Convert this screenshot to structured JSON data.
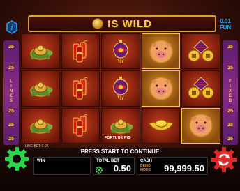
{
  "banner": {
    "title": "IS WILD"
  },
  "denomination": {
    "line1": "0.01",
    "line2": "FUN"
  },
  "side_left": {
    "numbers": [
      "25",
      "25",
      "25",
      "25",
      "25",
      "25"
    ],
    "label": "LINES"
  },
  "side_right": {
    "numbers": [
      "25",
      "25",
      "25",
      "25",
      "25",
      "25"
    ],
    "label": "FIXED"
  },
  "reels": [
    [
      "turtle",
      "turtle",
      "turtle"
    ],
    [
      "firecracker",
      "firecracker",
      "firecracker"
    ],
    [
      "lantern",
      "lantern",
      "turtle"
    ],
    [
      "pig",
      "pig",
      "ingot"
    ],
    [
      "coins",
      "coins",
      "pig"
    ]
  ],
  "reel_caption": "FORTUNE PIG",
  "line_bet_small": "LINE BET 0.02",
  "status": "PRESS START TO CONTINUE",
  "win": {
    "label": "WIN",
    "value": ""
  },
  "total_bet": {
    "label": "TOTAL BET",
    "value": "0.50"
  },
  "cash": {
    "label": "CASH",
    "value": "99,999.50",
    "mode": "DEMO MODE"
  },
  "colors": {
    "banner_text": "#ffcf3a",
    "denom": "#2aa8ff",
    "side_strip": "#8a2c86",
    "settings": "#2ad64a",
    "spin": "#e02a2a"
  }
}
